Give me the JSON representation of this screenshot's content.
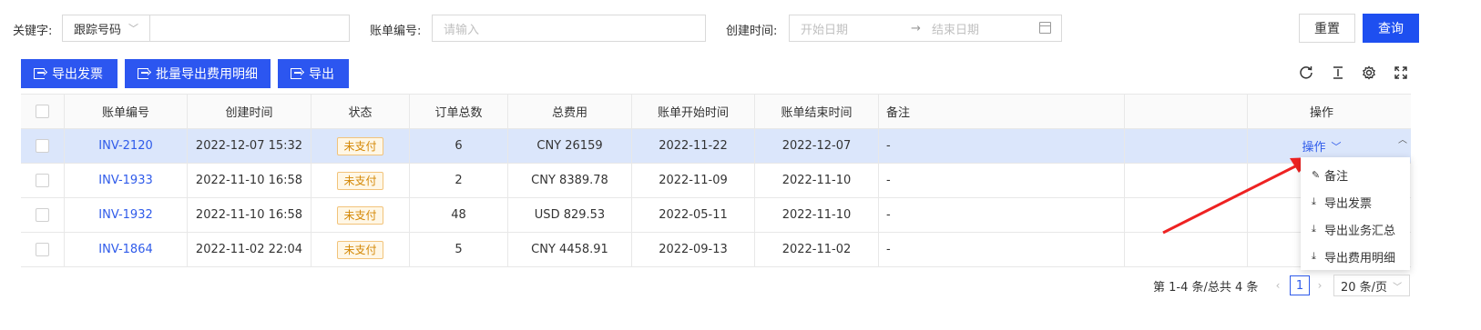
{
  "filters": {
    "keyword_label": "关键字:",
    "keyword_type": "跟踪号码",
    "keyword_value": "",
    "bill_no_label": "账单编号:",
    "bill_no_placeholder": "请输入",
    "created_label": "创建时间:",
    "date_start_placeholder": "开始日期",
    "date_end_placeholder": "结束日期",
    "date_arrow": "→",
    "reset_label": "重置",
    "query_label": "查询"
  },
  "toolbar": {
    "export_invoice": "导出发票",
    "batch_export": "批量导出费用明细",
    "export": "导出",
    "icons": [
      "refresh-icon",
      "column-height-icon",
      "settings-icon",
      "fullscreen-icon"
    ]
  },
  "table": {
    "headers": {
      "bill_no": "账单编号",
      "created": "创建时间",
      "status": "状态",
      "orders": "订单总数",
      "total_fee": "总费用",
      "start": "账单开始时间",
      "end": "账单结束时间",
      "remark": "备注",
      "action": "操作"
    },
    "rows": [
      {
        "bill_no": "INV-2120",
        "created": "2022-12-07 15:32",
        "status": "未支付",
        "orders": "6",
        "total_fee": "CNY 26159",
        "start": "2022-11-22",
        "end": "2022-12-07",
        "remark": "-",
        "action": "操作"
      },
      {
        "bill_no": "INV-1933",
        "created": "2022-11-10 16:58",
        "status": "未支付",
        "orders": "2",
        "total_fee": "CNY 8389.78",
        "start": "2022-11-09",
        "end": "2022-11-10",
        "remark": "-"
      },
      {
        "bill_no": "INV-1932",
        "created": "2022-11-10 16:58",
        "status": "未支付",
        "orders": "48",
        "total_fee": "USD 829.53",
        "start": "2022-05-11",
        "end": "2022-11-10",
        "remark": "-"
      },
      {
        "bill_no": "INV-1864",
        "created": "2022-11-02 22:04",
        "status": "未支付",
        "orders": "5",
        "total_fee": "CNY 4458.91",
        "start": "2022-09-13",
        "end": "2022-11-02",
        "remark": "-"
      }
    ]
  },
  "dropdown": {
    "items": [
      "备注",
      "导出发票",
      "导出业务汇总",
      "导出费用明细"
    ]
  },
  "pagination": {
    "total_text": "第 1-4 条/总共 4 条",
    "current_page": "1",
    "page_size": "20 条/页"
  },
  "colors": {
    "primary": "#2c56f0",
    "link": "#2f5bea",
    "active_row": "#dbe6fb",
    "annotation_arrow": "#ee2222"
  }
}
